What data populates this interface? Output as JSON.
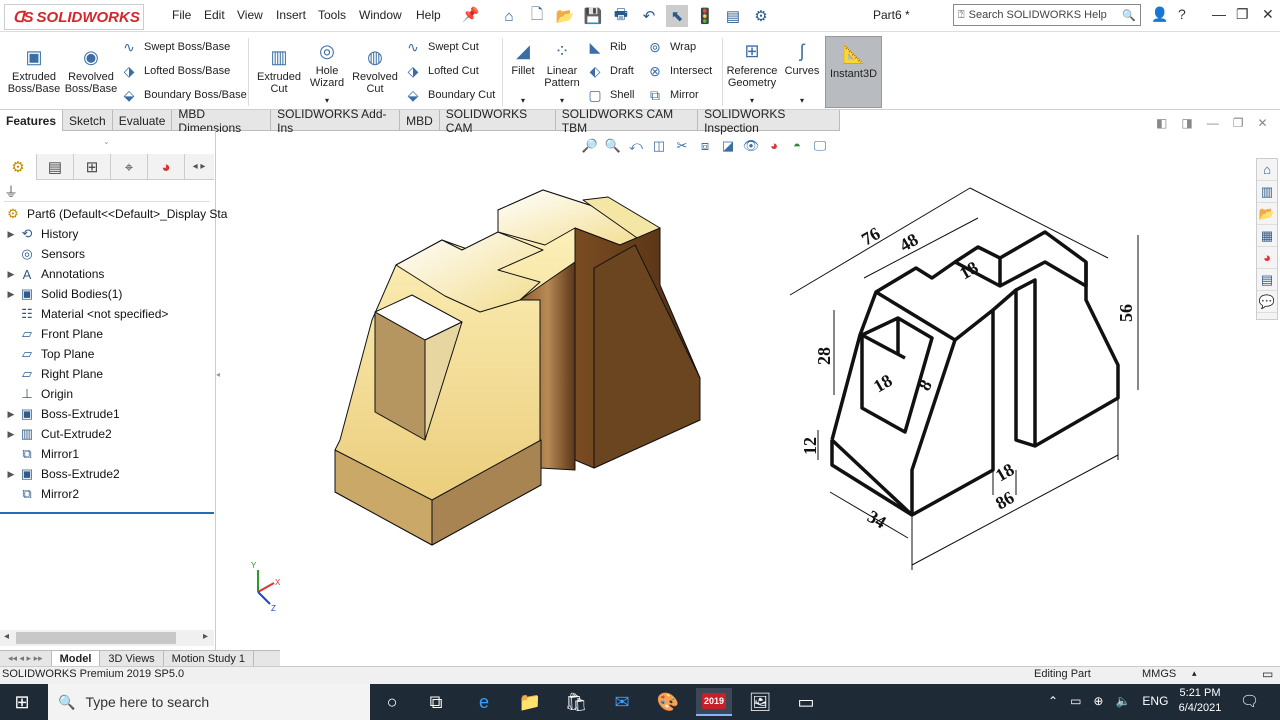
{
  "app": {
    "brand": "SOLIDWORKS",
    "document_title": "Part6 *",
    "search_placeholder": "Search SOLIDWORKS Help"
  },
  "menu": [
    "File",
    "Edit",
    "View",
    "Insert",
    "Tools",
    "Window",
    "Help"
  ],
  "command_manager": {
    "extruded_boss": "Extruded Boss/Base",
    "revolved_boss": "Revolved Boss/Base",
    "swept_boss": "Swept Boss/Base",
    "lofted_boss": "Lofted Boss/Base",
    "boundary_boss": "Boundary Boss/Base",
    "extruded_cut": "Extruded Cut",
    "hole_wizard": "Hole Wizard",
    "revolved_cut": "Revolved Cut",
    "swept_cut": "Swept Cut",
    "lofted_cut": "Lofted Cut",
    "boundary_cut": "Boundary Cut",
    "fillet": "Fillet",
    "linear_pattern": "Linear Pattern",
    "rib": "Rib",
    "draft": "Draft",
    "shell": "Shell",
    "wrap": "Wrap",
    "intersect": "Intersect",
    "mirror": "Mirror",
    "reference_geometry": "Reference Geometry",
    "curves": "Curves",
    "instant3d": "Instant3D"
  },
  "tabs": [
    "Features",
    "Sketch",
    "Evaluate",
    "MBD Dimensions",
    "SOLIDWORKS Add-Ins",
    "MBD",
    "SOLIDWORKS CAM",
    "SOLIDWORKS CAM TBM",
    "SOLIDWORKS Inspection"
  ],
  "tree": {
    "root": "Part6  (Default<<Default>_Display Sta",
    "items": [
      {
        "label": "History",
        "expandable": true,
        "icon": "history-icon"
      },
      {
        "label": "Sensors",
        "expandable": false,
        "icon": "sensor-icon"
      },
      {
        "label": "Annotations",
        "expandable": true,
        "icon": "annotation-icon"
      },
      {
        "label": "Solid Bodies(1)",
        "expandable": true,
        "icon": "solid-bodies-icon"
      },
      {
        "label": "Material <not specified>",
        "expandable": false,
        "icon": "material-icon"
      },
      {
        "label": "Front Plane",
        "expandable": false,
        "icon": "plane-icon"
      },
      {
        "label": "Top Plane",
        "expandable": false,
        "icon": "plane-icon"
      },
      {
        "label": "Right Plane",
        "expandable": false,
        "icon": "plane-icon"
      },
      {
        "label": "Origin",
        "expandable": false,
        "icon": "origin-icon"
      },
      {
        "label": "Boss-Extrude1",
        "expandable": true,
        "icon": "extrude-icon"
      },
      {
        "label": "Cut-Extrude2",
        "expandable": true,
        "icon": "cut-extrude-icon"
      },
      {
        "label": "Mirror1",
        "expandable": false,
        "icon": "mirror-icon"
      },
      {
        "label": "Boss-Extrude2",
        "expandable": true,
        "icon": "extrude-icon"
      },
      {
        "label": "Mirror2",
        "expandable": false,
        "icon": "mirror-icon"
      }
    ]
  },
  "bottom_tabs": [
    "Model",
    "3D Views",
    "Motion Study 1"
  ],
  "status": {
    "version": "SOLIDWORKS Premium 2019 SP5.0",
    "mode": "Editing Part",
    "units": "MMGS"
  },
  "drawing_dims": [
    "76",
    "48",
    "18",
    "56",
    "28",
    "18",
    "8",
    "12",
    "18",
    "34",
    "86"
  ],
  "axis_labels": {
    "x": "X",
    "y": "Y",
    "z": "Z"
  },
  "taskbar": {
    "search_placeholder": "Type here to search",
    "lang": "ENG",
    "time": "5:21 PM",
    "date": "6/4/2021",
    "sw_badge": "2019"
  },
  "colors": {
    "accent": "#d6262b",
    "selection": "#1e6fb8",
    "model_face_light": "#f5e6a0",
    "model_face_dark": "#6b4420"
  }
}
